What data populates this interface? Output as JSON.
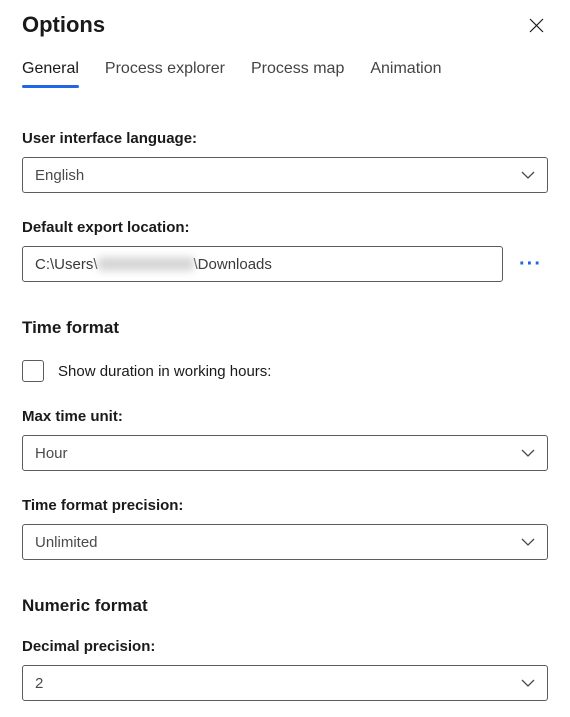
{
  "header": {
    "title": "Options"
  },
  "tabs": {
    "general": "General",
    "process_explorer": "Process explorer",
    "process_map": "Process map",
    "animation": "Animation"
  },
  "general": {
    "language_label": "User interface language:",
    "language_value": "English",
    "export_label": "Default export location:",
    "export_prefix": "C:\\Users\\",
    "export_suffix": "\\Downloads"
  },
  "time_format": {
    "section_title": "Time format",
    "checkbox_label": "Show duration in working hours:",
    "max_unit_label": "Max time unit:",
    "max_unit_value": "Hour",
    "precision_label": "Time format precision:",
    "precision_value": "Unlimited"
  },
  "numeric_format": {
    "section_title": "Numeric format",
    "decimal_label": "Decimal precision:",
    "decimal_value": "2"
  }
}
